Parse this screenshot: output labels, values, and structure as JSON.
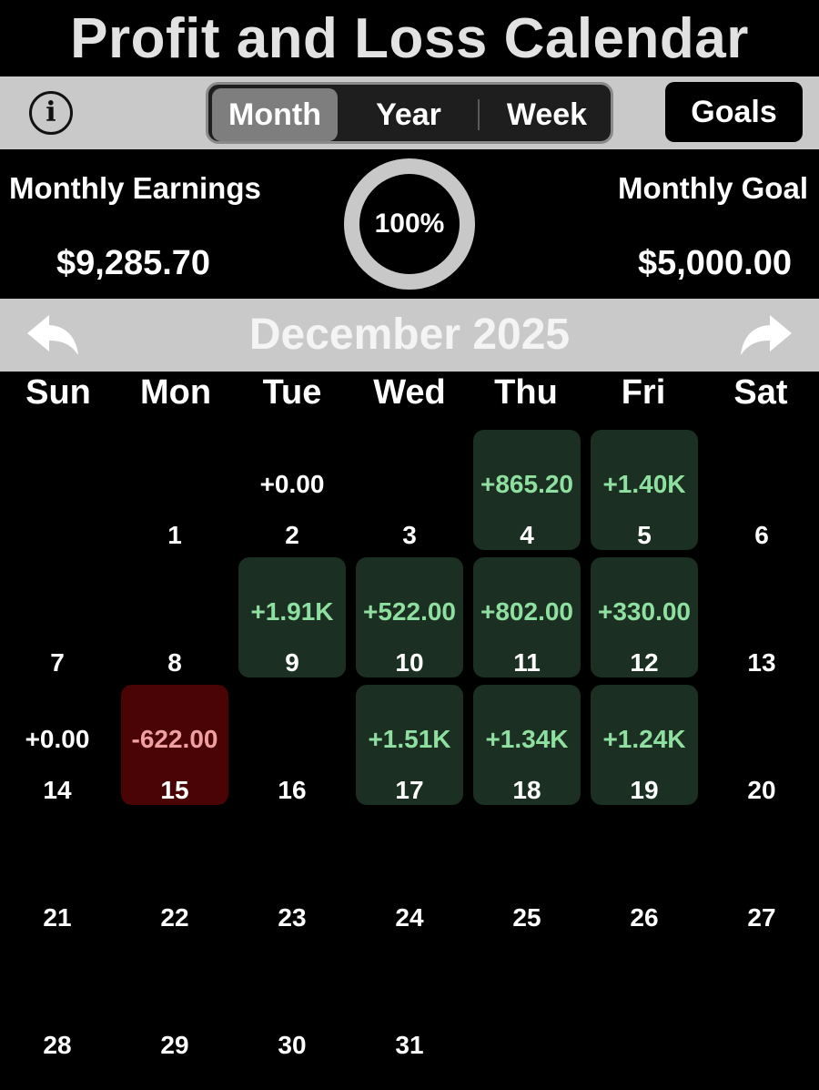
{
  "header": {
    "title": "Profit and Loss Calendar"
  },
  "toolbar": {
    "info_icon": "info-circle-icon",
    "info_glyph": "i",
    "segments": [
      {
        "label": "Month",
        "active": true
      },
      {
        "label": "Year",
        "active": false
      },
      {
        "label": "Week",
        "active": false
      }
    ],
    "goals_label": "Goals"
  },
  "summary": {
    "earnings_label": "Monthly Earnings",
    "earnings_value": "$9,285.70",
    "progress_text": "100%",
    "progress_fraction": 1.0,
    "goal_label": "Monthly Goal",
    "goal_value": "$5,000.00"
  },
  "calendar": {
    "month_title": "December 2025",
    "prev_icon": "back-arrow-icon",
    "next_icon": "forward-arrow-icon",
    "weekdays": [
      "Sun",
      "Mon",
      "Tue",
      "Wed",
      "Thu",
      "Fri",
      "Sat"
    ],
    "days": [
      {
        "day": "1",
        "pnl": "",
        "kind": "none"
      },
      {
        "day": "2",
        "pnl": "+0.00",
        "kind": "zero"
      },
      {
        "day": "3",
        "pnl": "",
        "kind": "none"
      },
      {
        "day": "4",
        "pnl": "+865.20",
        "kind": "pos"
      },
      {
        "day": "5",
        "pnl": "+1.40K",
        "kind": "pos"
      },
      {
        "day": "6",
        "pnl": "",
        "kind": "none"
      },
      {
        "day": "7",
        "pnl": "",
        "kind": "none"
      },
      {
        "day": "8",
        "pnl": "",
        "kind": "none"
      },
      {
        "day": "9",
        "pnl": "+1.91K",
        "kind": "pos"
      },
      {
        "day": "10",
        "pnl": "+522.00",
        "kind": "pos"
      },
      {
        "day": "11",
        "pnl": "+802.00",
        "kind": "pos"
      },
      {
        "day": "12",
        "pnl": "+330.00",
        "kind": "pos"
      },
      {
        "day": "13",
        "pnl": "",
        "kind": "none"
      },
      {
        "day": "14",
        "pnl": "+0.00",
        "kind": "zero"
      },
      {
        "day": "15",
        "pnl": "-622.00",
        "kind": "neg"
      },
      {
        "day": "16",
        "pnl": "",
        "kind": "none"
      },
      {
        "day": "17",
        "pnl": "+1.51K",
        "kind": "pos"
      },
      {
        "day": "18",
        "pnl": "+1.34K",
        "kind": "pos"
      },
      {
        "day": "19",
        "pnl": "+1.24K",
        "kind": "pos"
      },
      {
        "day": "20",
        "pnl": "",
        "kind": "none"
      },
      {
        "day": "21",
        "pnl": "",
        "kind": "none"
      },
      {
        "day": "22",
        "pnl": "",
        "kind": "none"
      },
      {
        "day": "23",
        "pnl": "",
        "kind": "none"
      },
      {
        "day": "24",
        "pnl": "",
        "kind": "none"
      },
      {
        "day": "25",
        "pnl": "",
        "kind": "none"
      },
      {
        "day": "26",
        "pnl": "",
        "kind": "none"
      },
      {
        "day": "27",
        "pnl": "",
        "kind": "none"
      },
      {
        "day": "28",
        "pnl": "",
        "kind": "none"
      },
      {
        "day": "29",
        "pnl": "",
        "kind": "none"
      },
      {
        "day": "30",
        "pnl": "",
        "kind": "none"
      },
      {
        "day": "31",
        "pnl": "",
        "kind": "none"
      }
    ]
  },
  "colors": {
    "positive_bg": "#1b3022",
    "positive_text": "#8fe0a0",
    "negative_bg": "#4a0405",
    "negative_text": "#f0a0a0",
    "bar_gray": "#c9c9c9"
  }
}
